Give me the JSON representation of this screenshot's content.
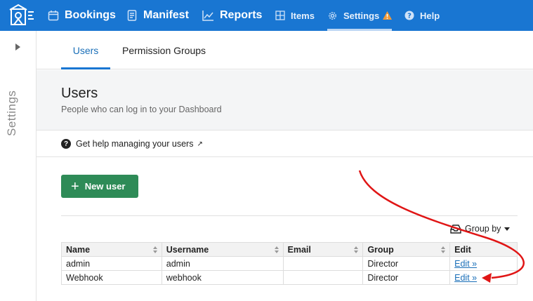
{
  "nav": {
    "items": [
      {
        "label": "Bookings",
        "icon": "calendar-icon"
      },
      {
        "label": "Manifest",
        "icon": "manifest-icon"
      },
      {
        "label": "Reports",
        "icon": "chart-icon"
      },
      {
        "label": "Items",
        "icon": "grid-icon"
      },
      {
        "label": "Settings",
        "icon": "gear-icon"
      },
      {
        "label": "Help",
        "icon": "help-icon"
      }
    ]
  },
  "sidebar": {
    "label": "Settings"
  },
  "tabs": [
    {
      "label": "Users"
    },
    {
      "label": "Permission Groups"
    }
  ],
  "page": {
    "title": "Users",
    "subtitle": "People who can log in to your Dashboard",
    "help_link": "Get help managing your users"
  },
  "actions": {
    "new_user": "New user",
    "group_by": "Group by"
  },
  "table": {
    "headers": [
      "Name",
      "Username",
      "Email",
      "Group",
      "Edit"
    ],
    "rows": [
      {
        "name": "admin",
        "username": "admin",
        "email": "",
        "group": "Director",
        "edit": "Edit »"
      },
      {
        "name": "Webhook",
        "username": "webhook",
        "email": "",
        "group": "Director",
        "edit": "Edit »"
      }
    ]
  },
  "colors": {
    "topbar": "#1976d2",
    "primary_button": "#2e8b57",
    "warning": "#f29a38",
    "annotation_arrow": "#e01515"
  }
}
